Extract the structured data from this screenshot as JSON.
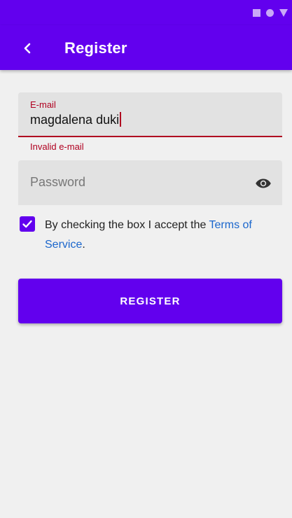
{
  "app_bar": {
    "title": "Register",
    "color": "#6200ee"
  },
  "status_bar": {
    "icons": [
      "square-icon",
      "dot-icon",
      "triangle-icon"
    ]
  },
  "email": {
    "label": "E-mail",
    "value": "magdalena duki",
    "error": "Invalid e-mail",
    "error_color": "#b00020"
  },
  "password": {
    "placeholder": "Password",
    "value": "",
    "toggle_icon": "eye-icon"
  },
  "terms": {
    "checked": true,
    "text_before": "By checking the box I accept the ",
    "link_text": "Terms of Service",
    "text_after": ".",
    "link_color": "#1a66cc"
  },
  "register_button": {
    "label": "REGISTER"
  }
}
